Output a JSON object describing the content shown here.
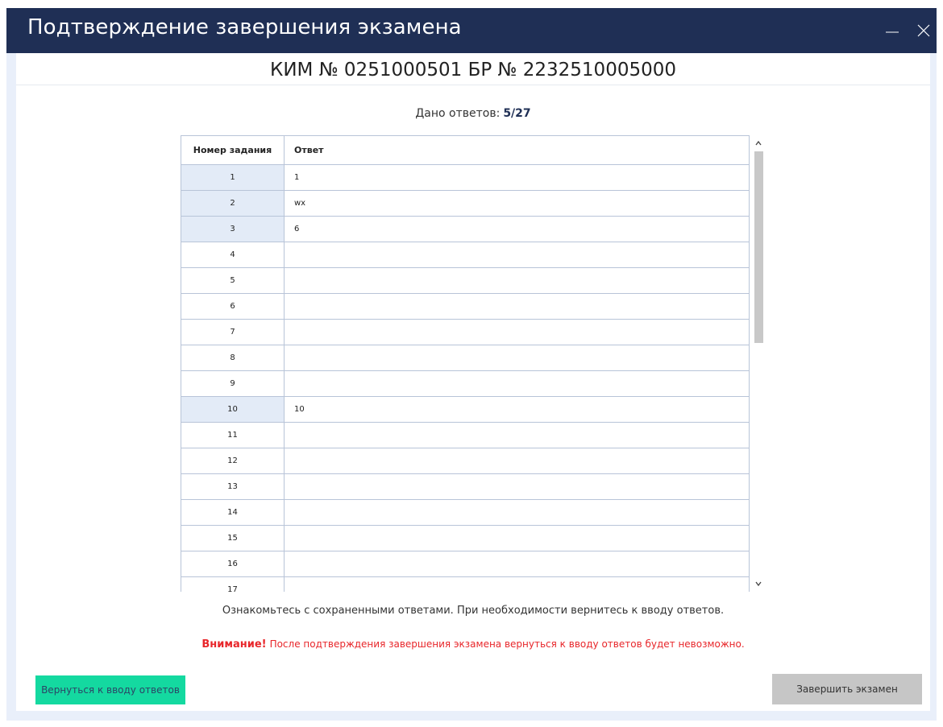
{
  "window": {
    "title": "Подтверждение завершения экзамена",
    "minimize_icon": "minimize-icon",
    "close_icon": "close-icon"
  },
  "header": {
    "kim_label": "КИМ № 0251000501 БР № 2232510005000"
  },
  "summary": {
    "label": "Дано ответов:",
    "value": "5/27"
  },
  "table": {
    "col_task": "Номер задания",
    "col_answer": "Ответ",
    "rows": [
      {
        "num": "1",
        "answer": "1"
      },
      {
        "num": "2",
        "answer": "wx"
      },
      {
        "num": "3",
        "answer": "6"
      },
      {
        "num": "4",
        "answer": ""
      },
      {
        "num": "5",
        "answer": ""
      },
      {
        "num": "6",
        "answer": ""
      },
      {
        "num": "7",
        "answer": ""
      },
      {
        "num": "8",
        "answer": ""
      },
      {
        "num": "9",
        "answer": ""
      },
      {
        "num": "10",
        "answer": "10"
      },
      {
        "num": "11",
        "answer": ""
      },
      {
        "num": "12",
        "answer": ""
      },
      {
        "num": "13",
        "answer": ""
      },
      {
        "num": "14",
        "answer": ""
      },
      {
        "num": "15",
        "answer": ""
      },
      {
        "num": "16",
        "answer": ""
      },
      {
        "num": "17",
        "answer": ""
      }
    ]
  },
  "notes": {
    "review": "Ознакомьтесь с сохраненными ответами. При необходимости вернитесь к вводу ответов.",
    "warning_prefix": "Внимание!",
    "warning_text": "После подтверждения завершения экзамена вернуться к вводу ответов будет невозможно."
  },
  "buttons": {
    "back": "Вернуться к вводу ответов",
    "finish": "Завершить экзамен"
  },
  "colors": {
    "titlebar": "#1f2f55",
    "back_button": "#14d9a0",
    "finish_button": "#c6c6c6",
    "warning": "#e8262a",
    "filled_cell": "#e3ebf7"
  }
}
